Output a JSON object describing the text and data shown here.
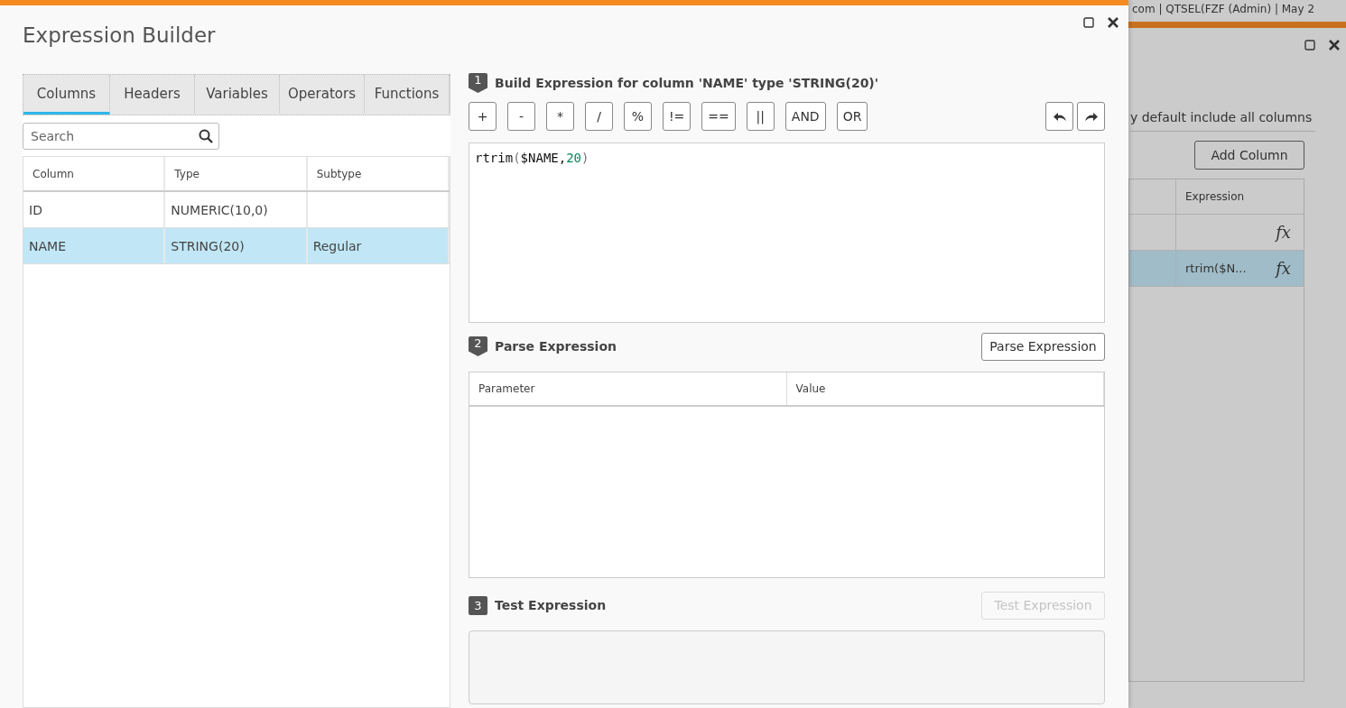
{
  "background_window": {
    "header_text": "com | QTSEL(FZF (Admin) | May 2",
    "note": "y default include all columns",
    "add_button": "Add Column",
    "table": {
      "columns": [
        "",
        "Expression"
      ],
      "rows": [
        {
          "expression": "",
          "action": "fx",
          "selected": false
        },
        {
          "expression": "rtrim($N...",
          "action": "fx",
          "selected": true
        }
      ]
    }
  },
  "dialog": {
    "title": "Expression Builder",
    "tabs": [
      {
        "label": "Columns",
        "selected": true
      },
      {
        "label": "Headers",
        "selected": false
      },
      {
        "label": "Variables",
        "selected": false
      },
      {
        "label": "Operators",
        "selected": false
      },
      {
        "label": "Functions",
        "selected": false
      }
    ],
    "search": {
      "placeholder": "Search"
    },
    "columns_table": {
      "columns": [
        "Column",
        "Type",
        "Subtype"
      ],
      "rows": [
        {
          "cells": [
            "ID",
            "NUMERIC(10,0)",
            ""
          ],
          "selected": false
        },
        {
          "cells": [
            "NAME",
            "STRING(20)",
            "Regular"
          ],
          "selected": true
        }
      ]
    },
    "steps": [
      {
        "number": "1",
        "title": "Build Expression for column 'NAME' type 'STRING(20)'",
        "kind": "build",
        "operators": [
          "+",
          "-",
          "*",
          "/",
          "%",
          "!=",
          "==",
          "||",
          "AND",
          "OR"
        ],
        "expression": [
          {
            "text": "rtrim",
            "kind": "name"
          },
          {
            "text": "(",
            "kind": "paren"
          },
          {
            "text": "$NAME,",
            "kind": "name"
          },
          {
            "text": "20",
            "kind": "number"
          },
          {
            "text": ")",
            "kind": "paren"
          }
        ]
      },
      {
        "number": "2",
        "title": "Parse Expression",
        "kind": "parse",
        "button": {
          "label": "Parse Expression",
          "disabled": false
        },
        "columns": [
          "Parameter",
          "Value"
        ]
      },
      {
        "number": "3",
        "title": "Test Expression",
        "kind": "test",
        "button": {
          "label": "Test Expression",
          "disabled": true
        }
      }
    ]
  }
}
